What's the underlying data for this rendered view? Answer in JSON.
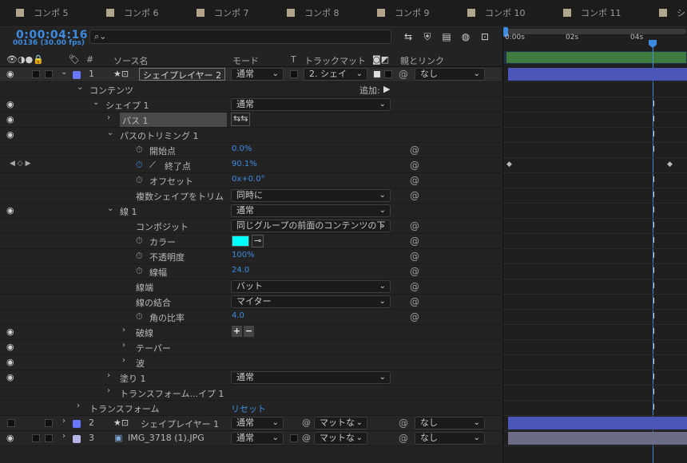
{
  "tabs": [
    "コンポ 5",
    "コンポ 6",
    "コンポ 7",
    "コンポ 8",
    "コンポ 9",
    "コンポ 10",
    "コンポ 11",
    "シ"
  ],
  "timecode": "0:00:04:16",
  "frame_info": "00136 (30.00 fps)",
  "search": {
    "placeholder": ""
  },
  "columns": {
    "num": "#",
    "source": "ソース名",
    "mode": "モード",
    "t": "T",
    "trackmatte": "トラックマット",
    "parent": "親とリンク"
  },
  "ruler": {
    "t0": "0:00s",
    "t1": "02s",
    "t2": "04s"
  },
  "layer1": {
    "num": "1",
    "name": "シェイプレイヤー 2",
    "mode": "通常",
    "matte": "2. シェイ",
    "parent": "なし",
    "color": "#6a78ff"
  },
  "contents": {
    "label": "コンテンツ",
    "add": "追加:"
  },
  "shape1": {
    "label": "シェイプ 1",
    "mode": "通常"
  },
  "path1": {
    "label": "パス 1"
  },
  "trim": {
    "label": "パスのトリミング 1",
    "start_label": "開始点",
    "start_value": "0.0%",
    "end_label": "終了点",
    "end_value": "90.1%",
    "offset_label": "オフセット",
    "offset_value": "0x+0.0°",
    "multi_label": "複数シェイプをトリム",
    "multi_value": "同時に"
  },
  "stroke": {
    "label": "線 1",
    "mode": "通常",
    "composite_label": "コンポジット",
    "composite_value": "同じグループの前面のコンテンツの下",
    "color_label": "カラー",
    "color": "#00ffff",
    "opacity_label": "不透明度",
    "opacity_value": "100%",
    "width_label": "線幅",
    "width_value": "24.0",
    "cap_label": "線端",
    "cap_value": "バット",
    "join_label": "線の結合",
    "join_value": "マイター",
    "miter_label": "角の比率",
    "miter_value": "4.0",
    "dash_label": "破線",
    "dash_plus": "+",
    "dash_minus": "−",
    "taper_label": "テーパー",
    "wave_label": "波"
  },
  "fill": {
    "label": "塗り 1",
    "mode": "通常"
  },
  "shape_transform": {
    "label": "トランスフォーム...イプ 1"
  },
  "layer_transform": {
    "label": "トランスフォーム",
    "reset": "リセット"
  },
  "layer2": {
    "num": "2",
    "name": "シェイプレイヤー 1",
    "mode": "通常",
    "matte": "マットな",
    "parent": "なし",
    "color": "#6a78ff"
  },
  "layer3": {
    "num": "3",
    "name": "IMG_3718 (1).JPG",
    "mode": "通常",
    "matte": "マットな",
    "parent": "なし",
    "color": "#b4b4e6"
  },
  "colors": {
    "accent": "#3d8be0",
    "layer_bar": "#4b56b8",
    "layer3_bar": "#6c6c86"
  }
}
